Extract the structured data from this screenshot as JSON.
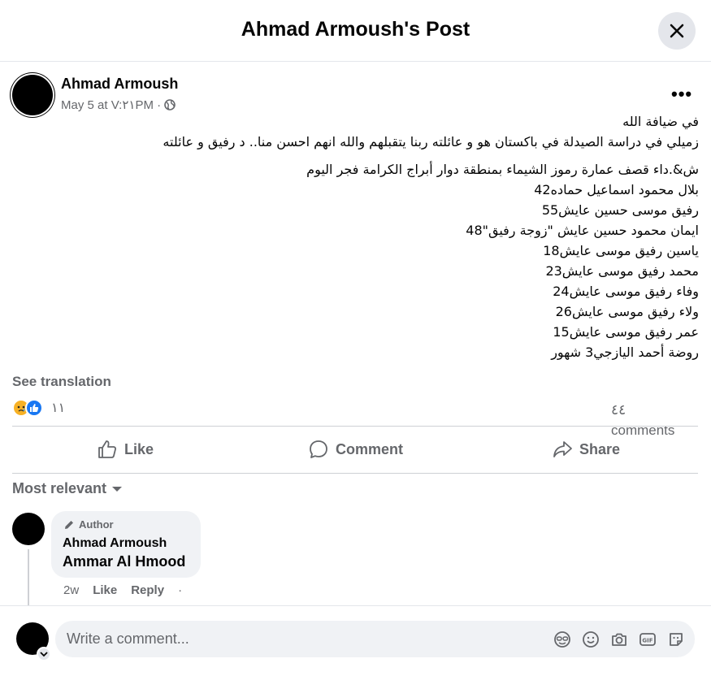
{
  "header": {
    "title": "Ahmad Armoush's Post"
  },
  "post": {
    "author": "Ahmad Armoush",
    "meta": "May 5 at V:٢١PM ·",
    "lines": [
      "في ضيافة الله",
      "زميلي في دراسة الصيدلة في باكستان هو و عائلته ربنا يتقبلهم والله انهم احسن منا.. د رفيق و عائلته",
      "ش&.داء قصف عمارة رموز الشيماء بمنطقة دوار أبراج الكرامة فجر اليوم",
      "بلال محمود اسماعيل حماده42",
      "رفيق موسى حسين عايش55",
      "ايمان محمود حسين عايش \"زوجة رفيق\"48",
      "ياسين رفيق موسى عايش18",
      "محمد رفيق موسى عايش23",
      "وفاء رفيق موسى عايش24",
      "ولاء رفيق موسى عايش26",
      "عمر رفيق موسى عايش15",
      "روضة أحمد اليازجي3 شهور"
    ],
    "see_translation": "See translation",
    "reaction_count": "١١",
    "comments_count": "٤٤ comments"
  },
  "actions": {
    "like": "Like",
    "comment": "Comment",
    "share": "Share"
  },
  "comments_section": {
    "sort_label": "Most relevant",
    "comment": {
      "badge": "Author",
      "author": "Ahmad Armoush",
      "text": "Ammar Al Hmood",
      "time": "2w",
      "like": "Like",
      "reply": "Reply",
      "dot": "·"
    }
  },
  "composer": {
    "placeholder": "Write a comment..."
  },
  "colors": {
    "accent": "#1877f2",
    "secondary_text": "#65676b",
    "bubble": "#f0f2f5",
    "sad_reaction": "#f7b125"
  },
  "icons": [
    "close-icon",
    "globe-icon",
    "more-icon",
    "sad-reaction-icon",
    "like-reaction-icon",
    "like-icon",
    "comment-icon",
    "share-icon",
    "caret-down-icon",
    "pencil-icon",
    "chevron-down-icon",
    "avatar-sticker-icon",
    "emoji-icon",
    "camera-icon",
    "gif-icon",
    "sticker-icon"
  ]
}
